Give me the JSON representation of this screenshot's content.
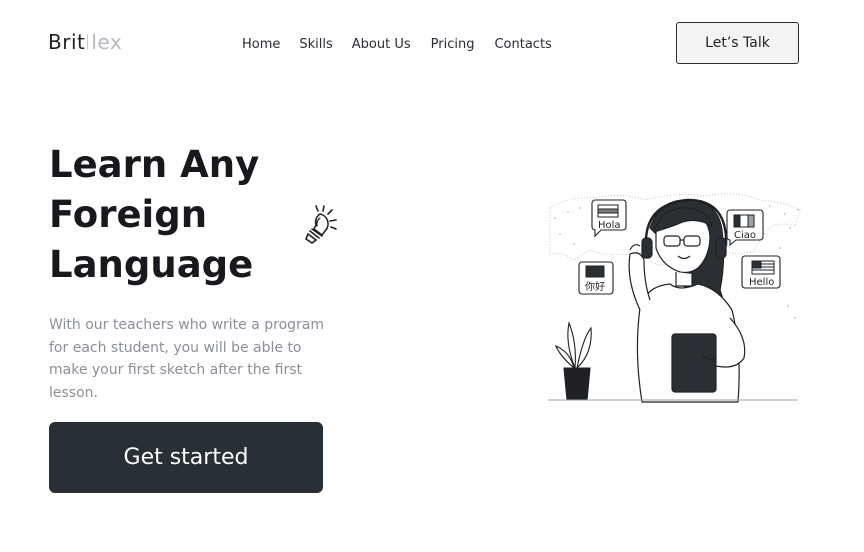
{
  "brand": {
    "name_primary": "Brit",
    "name_secondary": "lex"
  },
  "nav": {
    "items": [
      "Home",
      "Skills",
      "About Us",
      "Pricing",
      "Contacts"
    ]
  },
  "header": {
    "cta_label": "Let’s Talk"
  },
  "hero": {
    "title_lines": [
      "Learn Any",
      "Foreign",
      "Language"
    ],
    "description_lines": [
      "With our teachers who write a program",
      "for each student, you will be able to",
      "make your first sketch after the first",
      "lesson."
    ],
    "cta_label": "Get started"
  },
  "illustration": {
    "bubbles": [
      "Hola",
      "Ciao",
      "你好",
      "Hello"
    ]
  },
  "colors": {
    "text_dark": "#17191c",
    "text_muted": "#8b8f96",
    "button_dark": "#283036",
    "button_light": "#f4f4f5"
  },
  "icons": [
    "lightbulb-icon",
    "language-learning-illustration"
  ]
}
